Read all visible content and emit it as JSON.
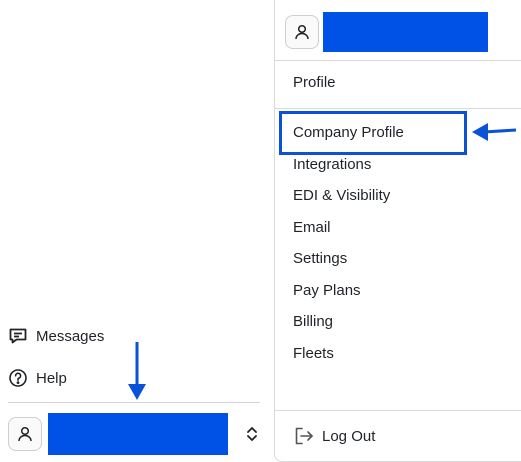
{
  "sidebar": {
    "messages_label": "Messages",
    "messages_icon": "message-icon",
    "help_label": "Help",
    "help_icon": "help-icon",
    "account_icon": "user-icon",
    "switcher_icon": "chevron-up-down-icon"
  },
  "menu": {
    "header_icon": "user-icon",
    "profile_label": "Profile",
    "items": [
      {
        "label": "Company Profile"
      },
      {
        "label": "Integrations"
      },
      {
        "label": "EDI & Visibility"
      },
      {
        "label": "Email"
      },
      {
        "label": "Settings"
      },
      {
        "label": "Pay Plans"
      },
      {
        "label": "Billing"
      },
      {
        "label": "Fleets"
      }
    ],
    "logout_label": "Log Out",
    "logout_icon": "log-out-icon"
  },
  "annotations": {
    "highlight_color": "#0a52d6",
    "redaction_color": "#0052e6"
  }
}
